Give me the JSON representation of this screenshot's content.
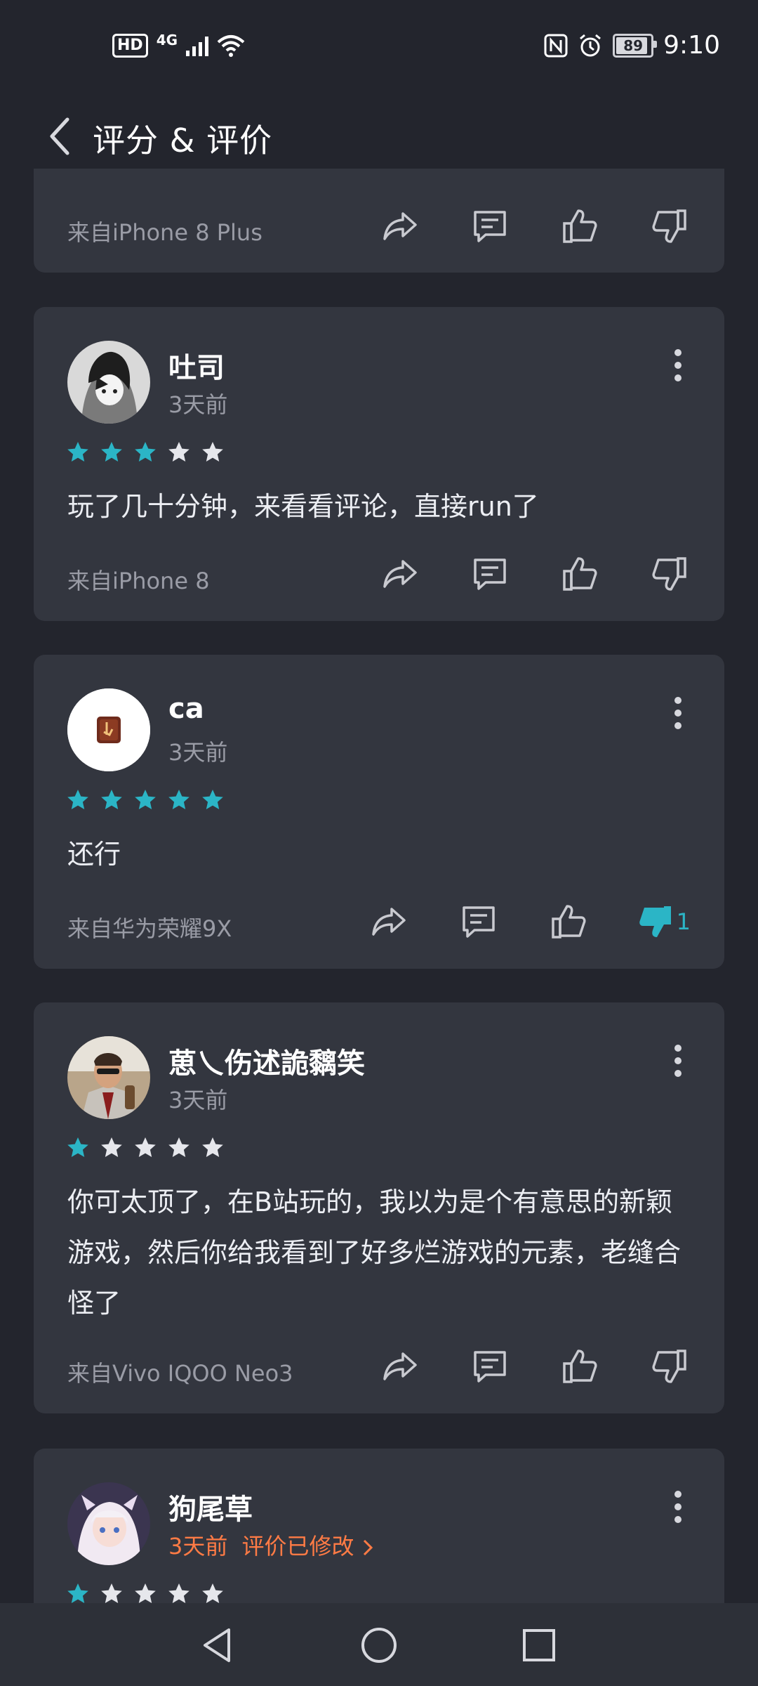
{
  "status_bar": {
    "hd": "HD",
    "network": "4G",
    "battery": "89",
    "time": "9:10"
  },
  "header": {
    "title": "评分 & 评价"
  },
  "reviews": [
    {
      "device": "来自iPhone 8 Plus"
    },
    {
      "username": "吐司",
      "time": "3天前",
      "stars": 3,
      "content": "玩了几十分钟，来看看评论，直接run了",
      "device": "来自iPhone 8"
    },
    {
      "username": "ca",
      "time": "3天前",
      "stars": 5,
      "content": "还行",
      "device": "来自华为荣耀9X",
      "dislike_count": "1"
    },
    {
      "username": "葸乀伤述詭黐笑",
      "time": "3天前",
      "stars": 1,
      "content": "你可太顶了，在B站玩的，我以为是个有意思的新颖游戏，然后你给我看到了好多烂游戏的元素，老缝合怪了",
      "device": "来自Vivo IQOO Neo3"
    },
    {
      "username": "狗尾草",
      "time": "3天前",
      "edited": "评价已修改",
      "stars": 1
    }
  ],
  "colors": {
    "background": "#23252d",
    "card": "#33363f",
    "star_active": "#2bb5c6",
    "star_inactive": "#e6e7ec",
    "edited": "#ff7b45"
  }
}
